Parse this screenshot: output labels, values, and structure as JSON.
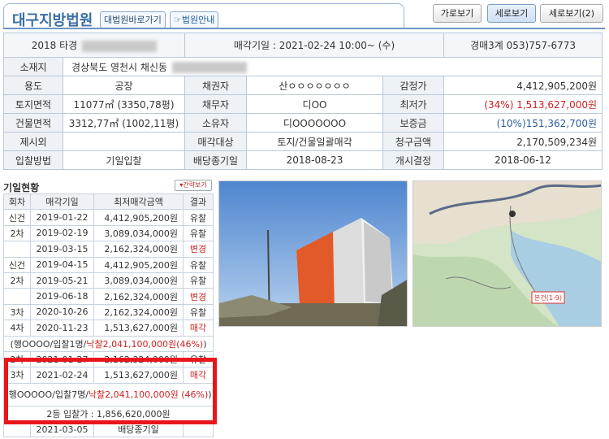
{
  "header": {
    "court": "대구지방법원",
    "court_link": "대법원바로가기",
    "guide_link": "법원안내",
    "views": [
      "가로보기",
      "세로보기",
      "세로보기(2)"
    ]
  },
  "summary": {
    "case": "2018 타경",
    "sale_date": "매각기일 : 2021-02-24 10:00~ (수)",
    "dept": "경매3계 053)757-6773"
  },
  "info": {
    "address_label": "소재지",
    "address": "경상북도 영천시 채신동",
    "rows": [
      [
        "용도",
        "공장",
        "채권자",
        "산ㅇㅇㅇㅇㅇㅇㅇ",
        "감정가",
        "4,412,905,200원"
      ],
      [
        "토지면적",
        "11077㎡ (3350,78평)",
        "채무자",
        "디OO",
        "최저가",
        "(34%) 1,513,627,000원"
      ],
      [
        "건물면적",
        "3312,77㎡ (1002,11평)",
        "소유자",
        "디OOOOOOO",
        "보증금",
        "(10%)151,362,700원"
      ],
      [
        "제시외",
        "",
        "매각대상",
        "토지/건물일괄매각",
        "청구금액",
        "2,170,509,234원"
      ],
      [
        "입찰방법",
        "기일입찰",
        "배당종기일",
        "2018-08-23",
        "개시결정",
        "2018-06-12"
      ]
    ]
  },
  "history": {
    "title": "기일현황",
    "toggle": "간략보기",
    "columns": [
      "회차",
      "매각기일",
      "최저매각금액",
      "결과"
    ],
    "rows": [
      [
        "신건",
        "2019-01-22",
        "4,412,905,200원",
        "유찰"
      ],
      [
        "2차",
        "2019-02-19",
        "3,089,034,000원",
        "유찰"
      ],
      [
        "",
        "2019-03-15",
        "2,162,324,000원",
        "변경"
      ],
      [
        "신건",
        "2019-04-15",
        "4,412,905,200원",
        "유찰"
      ],
      [
        "2차",
        "2019-05-21",
        "3,089,034,000원",
        "유찰"
      ],
      [
        "",
        "2019-06-18",
        "2,162,324,000원",
        "변경"
      ],
      [
        "3차",
        "2020-10-26",
        "2,162,324,000원",
        "유찰"
      ],
      [
        "4차",
        "2020-11-23",
        "1,513,627,000원",
        "매각"
      ]
    ],
    "note1_prefix": "(행OOOO/입찰1명/",
    "note1_red": "낙찰2,041,100,000원(46%)",
    "note1_suffix": ")",
    "row_after1": [
      "2차",
      "2021-01-27",
      "2,162,324,000원",
      "유찰"
    ],
    "row_highlight": [
      "3차",
      "2021-02-24",
      "1,513,627,000원",
      "매각"
    ],
    "note2_prefix": "(행OOOOO/입찰7명/",
    "note2_red": "낙찰2,041,100,000원 (46%)",
    "note2_suffix": ")",
    "second_bid": "2등 입찰가 : 1,856,620,000원",
    "last_row": [
      "",
      "2021-03-05",
      "배당종기일",
      ""
    ]
  },
  "map": {
    "label": "본건(1-9)"
  },
  "colors": {
    "accent": "#3a6ea5",
    "highlight": "#e8161b",
    "red": "#cc2222"
  }
}
